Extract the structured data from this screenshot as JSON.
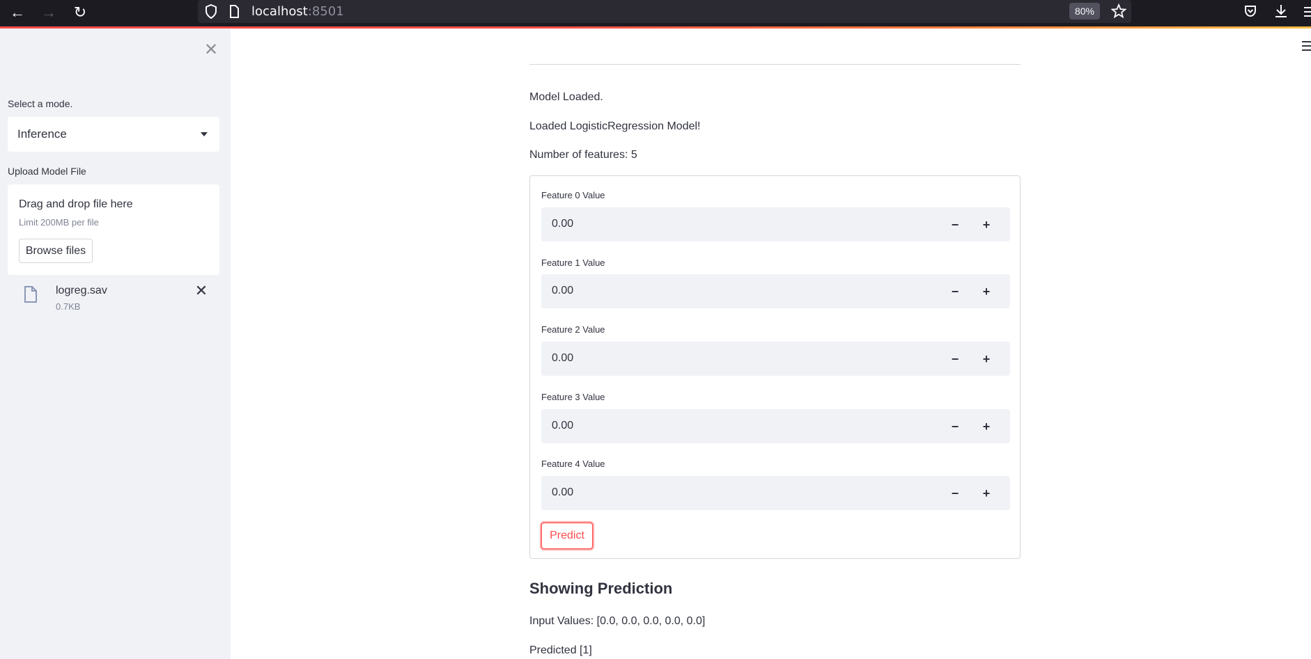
{
  "browser": {
    "url_host": "localhost",
    "url_port": ":8501",
    "zoom": "80%"
  },
  "sidebar": {
    "mode_label": "Select a mode.",
    "mode_value": "Inference",
    "upload_label": "Upload Model File",
    "dropzone_title": "Drag and drop file here",
    "dropzone_limit": "Limit 200MB per file",
    "browse_label": "Browse files",
    "file": {
      "name": "logreg.sav",
      "size": "0.7KB"
    }
  },
  "main": {
    "status_loaded": "Model Loaded.",
    "status_model": "Loaded LogisticRegression Model!",
    "num_features": "Number of features: 5",
    "features": [
      {
        "label": "Feature 0 Value",
        "value": "0.00"
      },
      {
        "label": "Feature 1 Value",
        "value": "0.00"
      },
      {
        "label": "Feature 2 Value",
        "value": "0.00"
      },
      {
        "label": "Feature 3 Value",
        "value": "0.00"
      },
      {
        "label": "Feature 4 Value",
        "value": "0.00"
      }
    ],
    "stepper_minus": "−",
    "stepper_plus": "+",
    "predict_label": "Predict",
    "prediction_heading": "Showing Prediction",
    "input_values": "Input Values: [0.0, 0.0, 0.0, 0.0, 0.0]",
    "predicted": "Predicted [1]"
  },
  "colors": {
    "accent": "#ff4b4b",
    "sidebar_bg": "#f0f2f6",
    "text": "#31333f"
  }
}
